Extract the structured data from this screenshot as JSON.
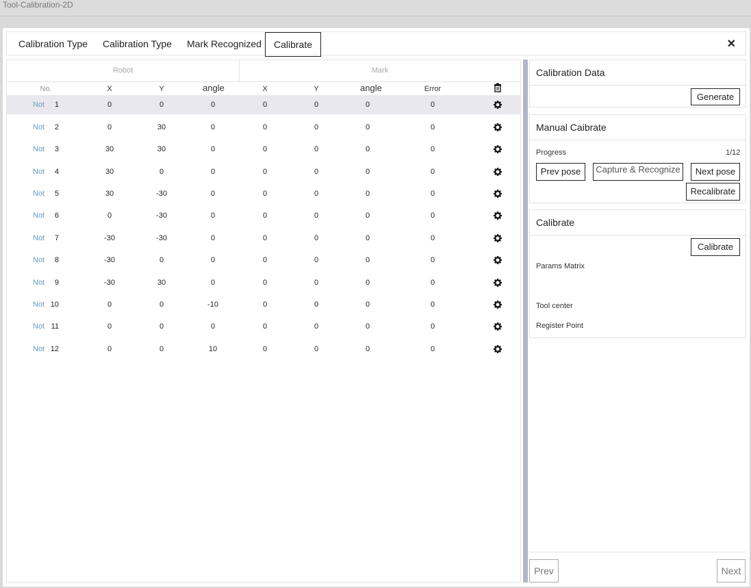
{
  "window_title": "Tool-Calibration-2D",
  "tabs": [
    "Calibration Type",
    "Calibration Type",
    "Mark Recognized",
    "Calibrate"
  ],
  "close_symbol": "✕",
  "table": {
    "group_robot": "Robot",
    "group_mark": "Mark",
    "headers": {
      "no": "No.",
      "rx": "X",
      "ry": "Y",
      "rangle": "angle",
      "mx": "X",
      "my": "Y",
      "mangle": "angle",
      "error": "Error"
    },
    "rows": [
      {
        "status": "Not",
        "no": "1",
        "rx": "0",
        "ry": "0",
        "rangle": "0",
        "mx": "0",
        "my": "0",
        "mangle": "0",
        "error": "0"
      },
      {
        "status": "Not",
        "no": "2",
        "rx": "0",
        "ry": "30",
        "rangle": "0",
        "mx": "0",
        "my": "0",
        "mangle": "0",
        "error": "0"
      },
      {
        "status": "Not",
        "no": "3",
        "rx": "30",
        "ry": "30",
        "rangle": "0",
        "mx": "0",
        "my": "0",
        "mangle": "0",
        "error": "0"
      },
      {
        "status": "Not",
        "no": "4",
        "rx": "30",
        "ry": "0",
        "rangle": "0",
        "mx": "0",
        "my": "0",
        "mangle": "0",
        "error": "0"
      },
      {
        "status": "Not",
        "no": "5",
        "rx": "30",
        "ry": "-30",
        "rangle": "0",
        "mx": "0",
        "my": "0",
        "mangle": "0",
        "error": "0"
      },
      {
        "status": "Not",
        "no": "6",
        "rx": "0",
        "ry": "-30",
        "rangle": "0",
        "mx": "0",
        "my": "0",
        "mangle": "0",
        "error": "0"
      },
      {
        "status": "Not",
        "no": "7",
        "rx": "-30",
        "ry": "-30",
        "rangle": "0",
        "mx": "0",
        "my": "0",
        "mangle": "0",
        "error": "0"
      },
      {
        "status": "Not",
        "no": "8",
        "rx": "-30",
        "ry": "0",
        "rangle": "0",
        "mx": "0",
        "my": "0",
        "mangle": "0",
        "error": "0"
      },
      {
        "status": "Not",
        "no": "9",
        "rx": "-30",
        "ry": "30",
        "rangle": "0",
        "mx": "0",
        "my": "0",
        "mangle": "0",
        "error": "0"
      },
      {
        "status": "Not",
        "no": "10",
        "rx": "0",
        "ry": "0",
        "rangle": "-10",
        "mx": "0",
        "my": "0",
        "mangle": "0",
        "error": "0"
      },
      {
        "status": "Not",
        "no": "11",
        "rx": "0",
        "ry": "0",
        "rangle": "0",
        "mx": "0",
        "my": "0",
        "mangle": "0",
        "error": "0"
      },
      {
        "status": "Not",
        "no": "12",
        "rx": "0",
        "ry": "0",
        "rangle": "10",
        "mx": "0",
        "my": "0",
        "mangle": "0",
        "error": "0"
      }
    ]
  },
  "calibration_data": {
    "title": "Calibration Data",
    "generate_label": "Generate"
  },
  "manual": {
    "title": "Manual Caibrate",
    "progress_label": "Progress",
    "progress_value": "1/12",
    "prev_pose_label": "Prev pose",
    "capture_label": "Capture & Recognize",
    "next_pose_label": "Next pose",
    "recalibrate_label": "Recalibrate"
  },
  "calibrate": {
    "title": "Calibrate",
    "button_label": "Calibrate",
    "params_matrix_label": "Params Matrix",
    "tool_center_label": "Tool center",
    "register_point_label": "Register Point"
  },
  "nav": {
    "prev_label": "Prev",
    "next_label": "Next"
  },
  "colors": {
    "status_text": "#5b9fd8",
    "selected_row": "#e8e8ee",
    "scrollbar": "#b2b6c9"
  },
  "icons": {
    "row_action": "gear-icon",
    "clear_all": "trash-icon",
    "close": "close-icon"
  }
}
